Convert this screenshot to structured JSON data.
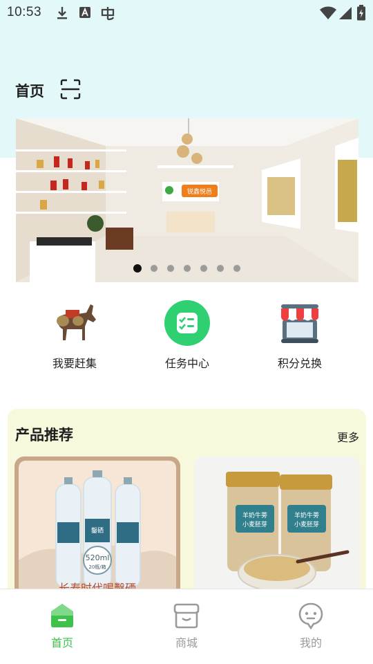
{
  "status_bar": {
    "time": "10:53",
    "left_icons": [
      "download-icon",
      "font-a-icon",
      "pinyin-input-icon"
    ],
    "right_icons": [
      "wifi-icon",
      "signal-icon",
      "battery-charging-icon"
    ]
  },
  "header": {
    "title": "首页",
    "scan_icon": "scan-icon"
  },
  "banner": {
    "logo_text": "锐鑫悦邑",
    "slide_count": 7,
    "active_slide": 1
  },
  "quick_entries": [
    {
      "label": "我要赶集",
      "icon": "donkey-icon"
    },
    {
      "label": "任务中心",
      "icon": "task-list-icon"
    },
    {
      "label": "积分兑换",
      "icon": "store-icon"
    }
  ],
  "products": {
    "title": "产品推荐",
    "more_label": "更多",
    "items": [
      {
        "badge": "520ml",
        "badge_sub": "20瓶/箱",
        "slogan": "长寿时代喝鑿硒",
        "bottle_brand": "鑿硒"
      },
      {
        "jar_label_line1": "羊奶牛蒡",
        "jar_label_line2": "小麦胚芽"
      }
    ]
  },
  "bottom_nav": [
    {
      "label": "首页",
      "icon": "home-icon",
      "active": true
    },
    {
      "label": "商城",
      "icon": "shop-icon",
      "active": false
    },
    {
      "label": "我的",
      "icon": "profile-icon",
      "active": false
    }
  ],
  "colors": {
    "accent": "#3ec24b",
    "header_bg": "#e3f8f8",
    "section_bg": "#f8f8dc"
  }
}
